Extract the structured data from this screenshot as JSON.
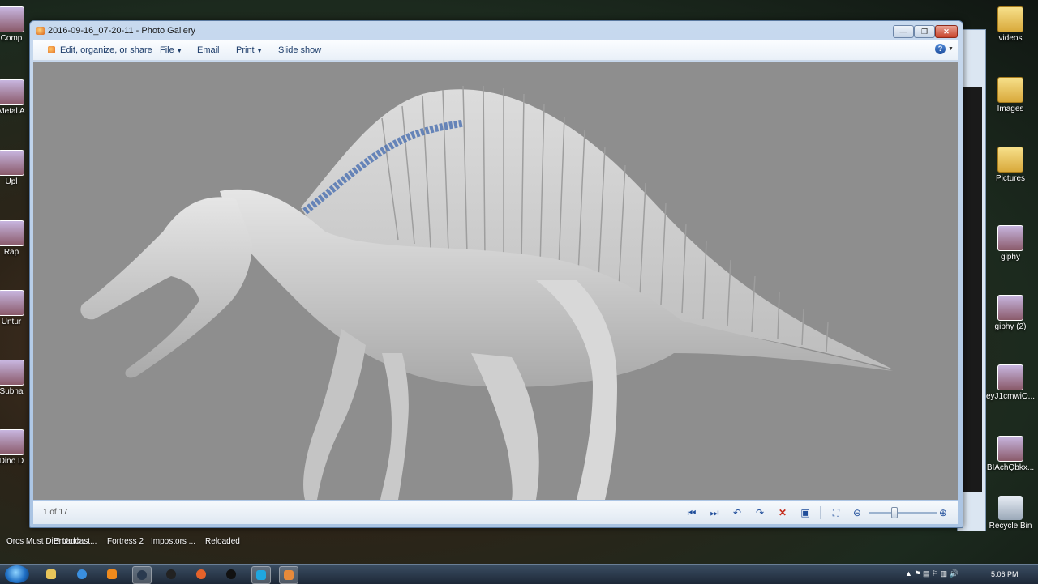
{
  "window": {
    "title": "2016-09-16_07-20-11 - Photo Gallery",
    "controls": {
      "minimize": "—",
      "maximize": "❐",
      "close": "✕"
    }
  },
  "menubar": {
    "edit": "Edit, organize, or share",
    "file": "File",
    "email": "Email",
    "print": "Print",
    "slideshow": "Slide show",
    "help": "?"
  },
  "status": {
    "count": "1 of 17"
  },
  "desktop": {
    "right_icons": [
      {
        "label": "videos",
        "icon": "folder-icon"
      },
      {
        "label": "Images",
        "icon": "folder-icon"
      },
      {
        "label": "Pictures",
        "icon": "folder-icon"
      },
      {
        "label": "giphy",
        "icon": "image-icon"
      },
      {
        "label": "giphy (2)",
        "icon": "image-icon"
      },
      {
        "label": "eyJ1cmwiO...",
        "icon": "image-icon"
      },
      {
        "label": "BIAchQbkx...",
        "icon": "image-icon"
      },
      {
        "label": "Recycle Bin",
        "icon": "recycle-bin-icon"
      }
    ],
    "left_icons": [
      "Comp",
      "Metal A",
      "Upl",
      "Rap",
      "Untur",
      "Subna",
      "Dino D"
    ],
    "bottom_labels": [
      "Orcs Must Die! Unch...",
      "Broadcast...",
      "Fortress 2",
      "Impostors ...",
      "Reloaded"
    ]
  },
  "taskbar": {
    "clock": "5:06 PM"
  },
  "colors": {
    "viewer_bg": "#8e8e8e",
    "accent": "#1f4d9a",
    "delete": "#c42b1c"
  }
}
